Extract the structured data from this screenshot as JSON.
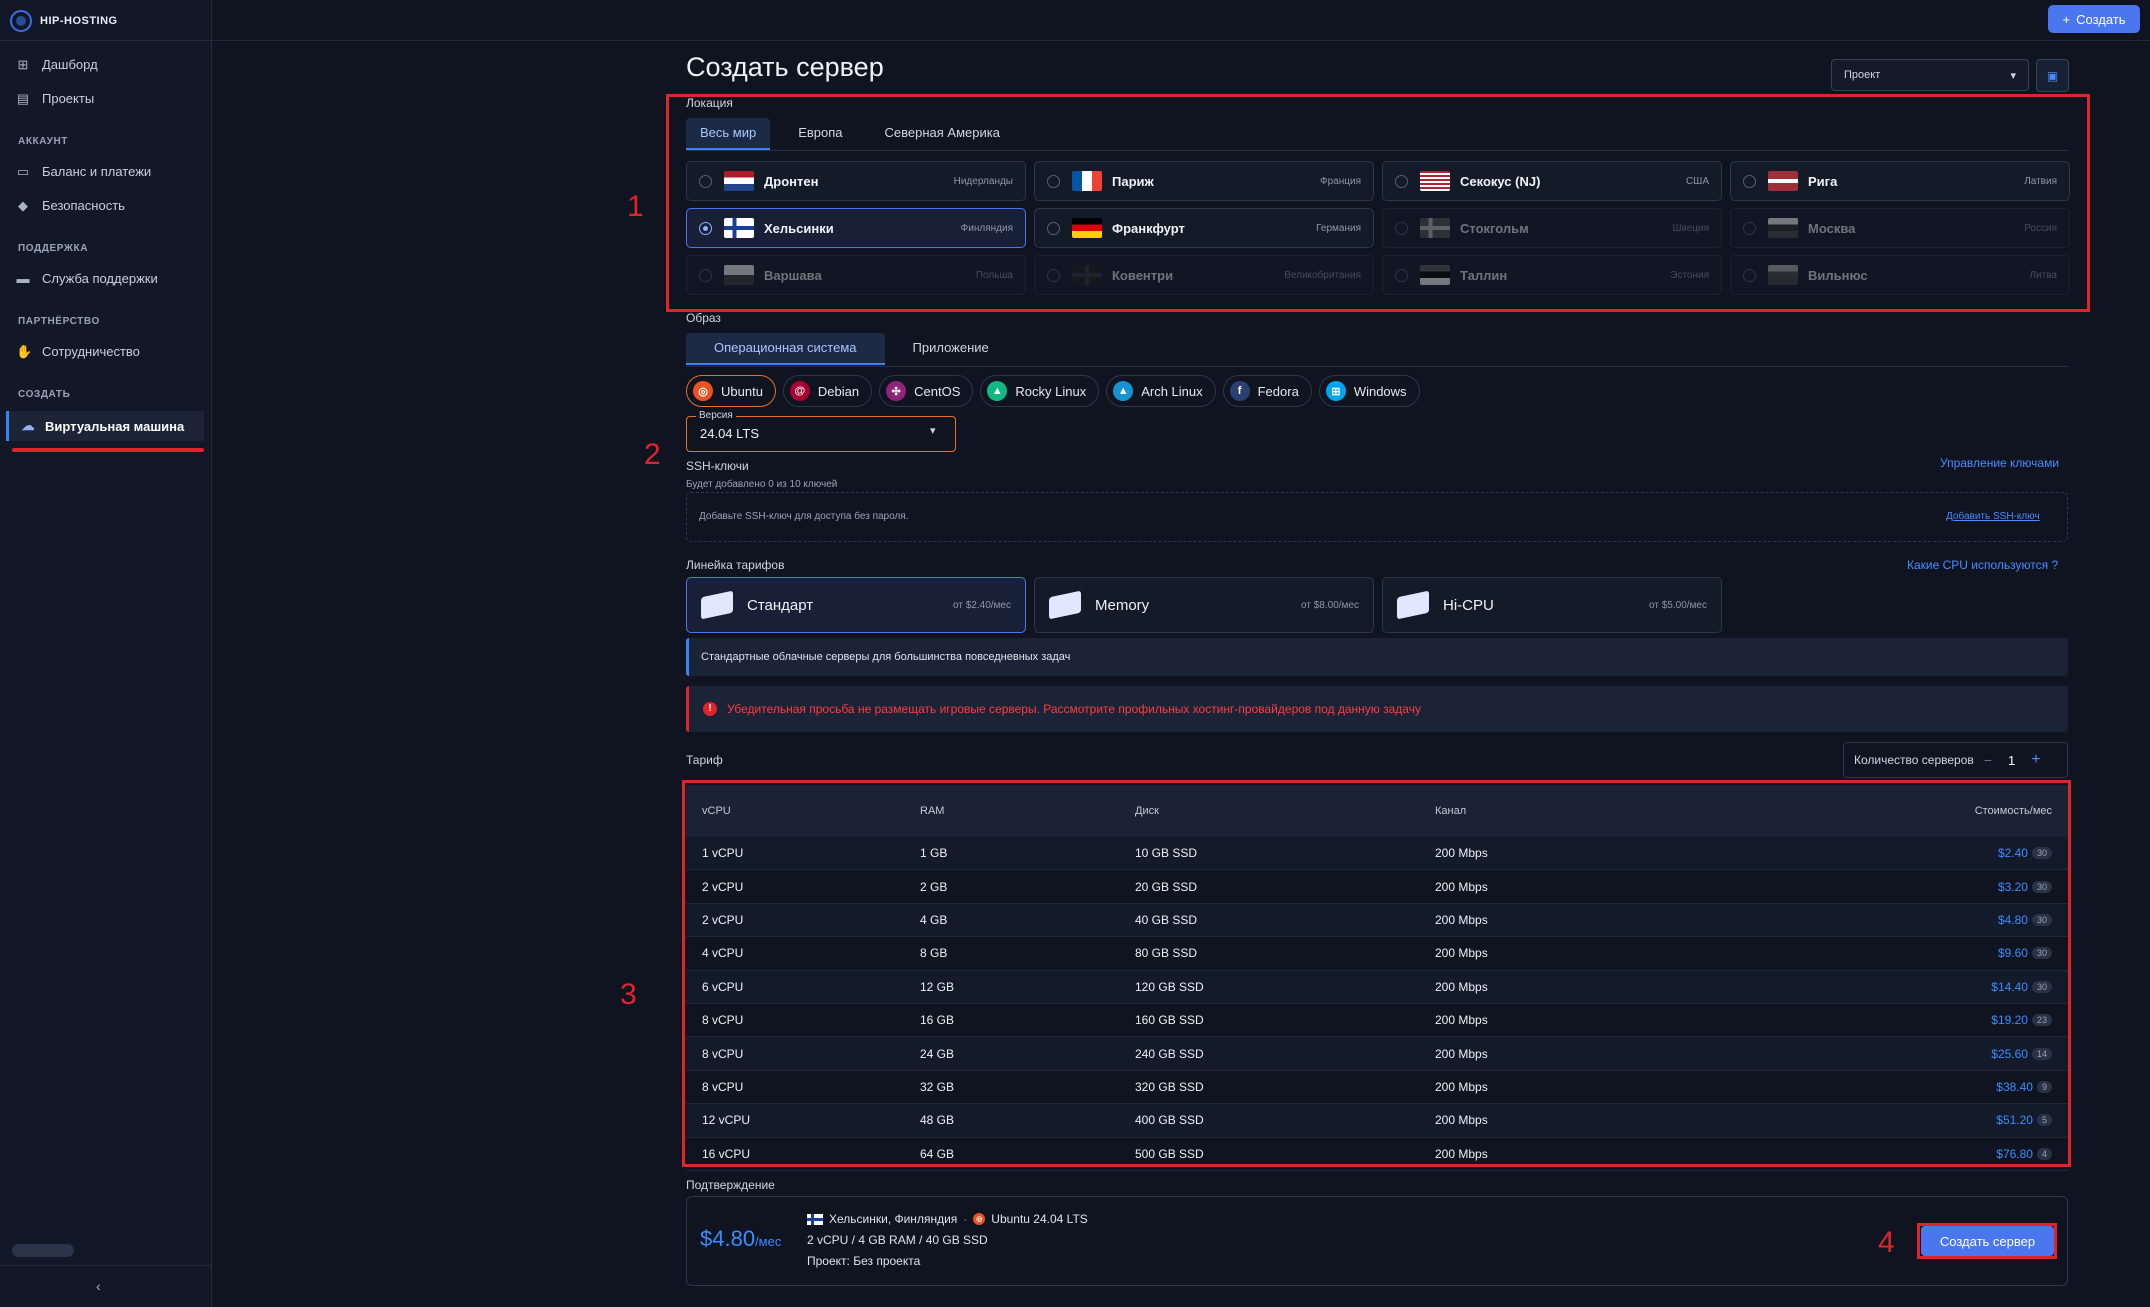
{
  "brand": {
    "name": "HIP-HOSTING"
  },
  "header": {
    "create_label": "Создать"
  },
  "sidebar": {
    "dashboard": "Дашборд",
    "projects": "Проекты",
    "section_account": "АККАУНТ",
    "billing": "Баланс и платежи",
    "security": "Безопасность",
    "section_support": "ПОДДЕРЖКА",
    "support": "Служба поддержки",
    "section_partner": "ПАРТНЁРСТВО",
    "partnership": "Сотрудничество",
    "section_create": "СОЗДАТЬ",
    "vm": "Виртуальная машина",
    "collapse": "‹"
  },
  "page": {
    "title": "Создать сервер",
    "project_placeholder": "Проект"
  },
  "location": {
    "label": "Локация",
    "tabs": [
      "Весь мир",
      "Европа",
      "Северная Америка"
    ],
    "items": [
      {
        "city": "Дронтен",
        "country": "Нидерланды",
        "selected": false,
        "disabled": false,
        "flag": "nl"
      },
      {
        "city": "Париж",
        "country": "Франция",
        "selected": false,
        "disabled": false,
        "flag": "fr"
      },
      {
        "city": "Секокус (NJ)",
        "country": "США",
        "selected": false,
        "disabled": false,
        "flag": "us"
      },
      {
        "city": "Рига",
        "country": "Латвия",
        "selected": false,
        "disabled": false,
        "flag": "lv"
      },
      {
        "city": "Хельсинки",
        "country": "Финляндия",
        "selected": true,
        "disabled": false,
        "flag": "fi"
      },
      {
        "city": "Франкфурт",
        "country": "Германия",
        "selected": false,
        "disabled": false,
        "flag": "de"
      },
      {
        "city": "Стокгольм",
        "country": "Швеция",
        "selected": false,
        "disabled": true,
        "flag": "se"
      },
      {
        "city": "Москва",
        "country": "Россия",
        "selected": false,
        "disabled": true,
        "flag": "ru"
      },
      {
        "city": "Варшава",
        "country": "Польша",
        "selected": false,
        "disabled": true,
        "flag": "pl"
      },
      {
        "city": "Ковентри",
        "country": "Великобритания",
        "selected": false,
        "disabled": true,
        "flag": "gb"
      },
      {
        "city": "Таллин",
        "country": "Эстония",
        "selected": false,
        "disabled": true,
        "flag": "ee"
      },
      {
        "city": "Вильнюс",
        "country": "Литва",
        "selected": false,
        "disabled": true,
        "flag": "lt"
      }
    ]
  },
  "image": {
    "label": "Образ",
    "tabs": [
      "Операционная система",
      "Приложение"
    ],
    "os": [
      {
        "name": "Ubuntu",
        "color": "#e95420",
        "glyph": "◎",
        "selected": true
      },
      {
        "name": "Debian",
        "color": "#a80030",
        "glyph": "@",
        "selected": false
      },
      {
        "name": "CentOS",
        "color": "#932279",
        "glyph": "✣",
        "selected": false
      },
      {
        "name": "Rocky Linux",
        "color": "#10b981",
        "glyph": "▲",
        "selected": false
      },
      {
        "name": "Arch Linux",
        "color": "#1793d1",
        "glyph": "▲",
        "selected": false
      },
      {
        "name": "Fedora",
        "color": "#294172",
        "glyph": "f",
        "selected": false
      },
      {
        "name": "Windows",
        "color": "#00a4ef",
        "glyph": "⊞",
        "selected": false
      }
    ],
    "version_label": "Версия",
    "version_value": "24.04 LTS"
  },
  "ssh": {
    "label": "SSH-ключи",
    "manage_link": "Управление ключами",
    "hint": "Будет добавлено 0 из 10 ключей",
    "box_text": "Добавьте SSH-ключ для доступа без пароля.",
    "add_link": "Добавить SSH-ключ"
  },
  "tiers": {
    "label": "Линейка тарифов",
    "cpu_link": "Какие CPU используются ?",
    "items": [
      {
        "name": "Стандарт",
        "price": "от $2.40/мес",
        "selected": true
      },
      {
        "name": "Memory",
        "price": "от $8.00/мес",
        "selected": false
      },
      {
        "name": "Hi-CPU",
        "price": "от $5.00/мес",
        "selected": false
      }
    ],
    "info": "Стандартные облачные серверы для большинства повседневных задач",
    "warning": "Убедительная просьба не размещать игровые серверы. Рассмотрите профильных хостинг-провайдеров под данную задачу"
  },
  "tariff": {
    "label": "Тариф",
    "qty_label": "Количество серверов",
    "qty_minus": "−",
    "qty_value": "1",
    "qty_plus": "+",
    "headers": [
      "vCPU",
      "RAM",
      "Диск",
      "Канал",
      "Стоимость/мес"
    ],
    "rows": [
      {
        "cpu": "1 vCPU",
        "ram": "1 GB",
        "disk": "10 GB SSD",
        "net": "200 Mbps",
        "price": "$2.40",
        "stock": "30"
      },
      {
        "cpu": "2 vCPU",
        "ram": "2 GB",
        "disk": "20 GB SSD",
        "net": "200 Mbps",
        "price": "$3.20",
        "stock": "30"
      },
      {
        "cpu": "2 vCPU",
        "ram": "4 GB",
        "disk": "40 GB SSD",
        "net": "200 Mbps",
        "price": "$4.80",
        "stock": "30"
      },
      {
        "cpu": "4 vCPU",
        "ram": "8 GB",
        "disk": "80 GB SSD",
        "net": "200 Mbps",
        "price": "$9.60",
        "stock": "30"
      },
      {
        "cpu": "6 vCPU",
        "ram": "12 GB",
        "disk": "120 GB SSD",
        "net": "200 Mbps",
        "price": "$14.40",
        "stock": "30"
      },
      {
        "cpu": "8 vCPU",
        "ram": "16 GB",
        "disk": "160 GB SSD",
        "net": "200 Mbps",
        "price": "$19.20",
        "stock": "23"
      },
      {
        "cpu": "8 vCPU",
        "ram": "24 GB",
        "disk": "240 GB SSD",
        "net": "200 Mbps",
        "price": "$25.60",
        "stock": "14"
      },
      {
        "cpu": "8 vCPU",
        "ram": "32 GB",
        "disk": "320 GB SSD",
        "net": "200 Mbps",
        "price": "$38.40",
        "stock": "9"
      },
      {
        "cpu": "12 vCPU",
        "ram": "48 GB",
        "disk": "400 GB SSD",
        "net": "200 Mbps",
        "price": "$51.20",
        "stock": "5"
      },
      {
        "cpu": "16 vCPU",
        "ram": "64 GB",
        "disk": "500 GB SSD",
        "net": "200 Mbps",
        "price": "$76.80",
        "stock": "4"
      }
    ]
  },
  "confirm": {
    "label": "Подтверждение",
    "price": "$4.80",
    "per": "/мес",
    "location": "Хельсинки, Финляндия",
    "sep": "·",
    "os": "Ubuntu 24.04 LTS",
    "specs": "2 vCPU / 4 GB RAM / 40 GB SSD",
    "project": "Проект: Без проекта",
    "submit": "Создать сервер"
  },
  "annotations": [
    "1",
    "2",
    "3",
    "4"
  ],
  "colors": {
    "accent": "#4a77f0",
    "link": "#3b8cff",
    "highlight": "#e2232a",
    "bg": "#0f1420"
  }
}
